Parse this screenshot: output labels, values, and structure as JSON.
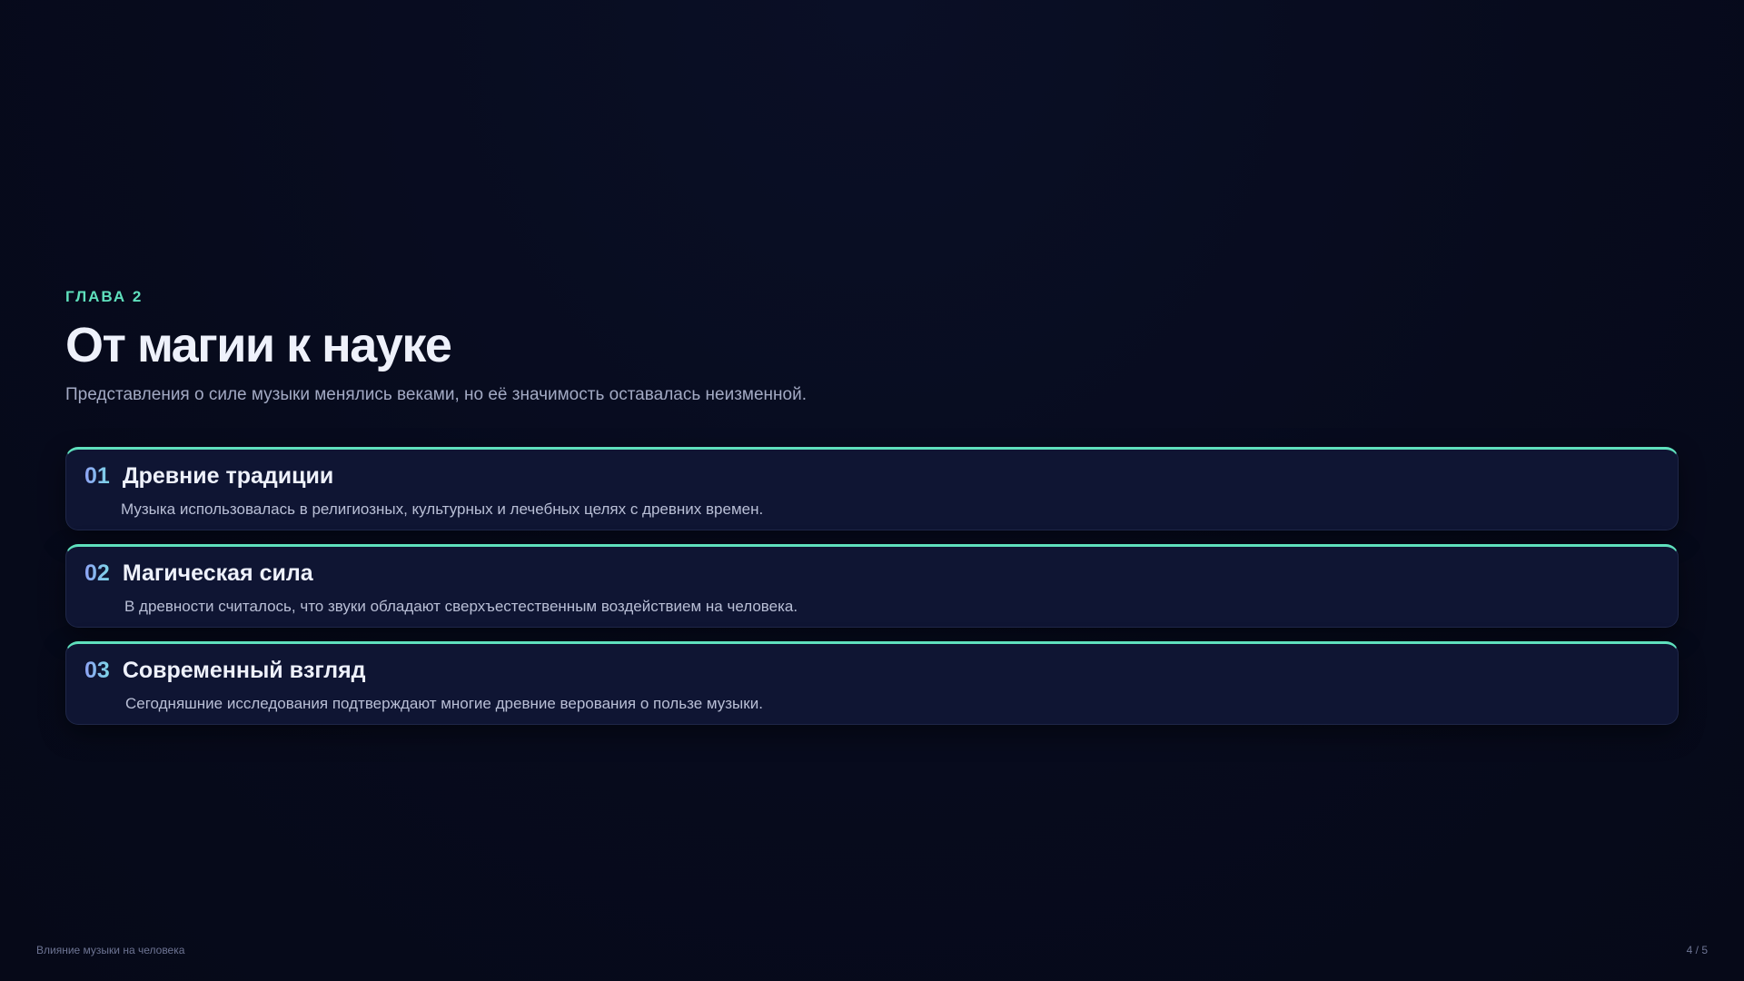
{
  "slide": {
    "eyebrow": "ГЛАВА 2",
    "title": "От магии к науке",
    "subtitle": "Представления о силе музыки менялись веками, но её значимость оставалась неизменной."
  },
  "cards": [
    {
      "number": "01",
      "title": "Древние традиции",
      "description": "Музыка использовалась в религиозных, культурных и лечебных целях с древних времен."
    },
    {
      "number": "02",
      "title": "Магическая сила",
      "description": "В древности считалось, что звуки обладают сверхъестественным воздействием на человека."
    },
    {
      "number": "03",
      "title": "Современный взгляд",
      "description": "Сегодняшние исследования подтверждают многие древние верования о пользе музыки."
    }
  ],
  "footer": {
    "presentation_title": "Влияние музыки на человека",
    "page_indicator": "4 / 5"
  },
  "colors": {
    "background": "#070b1d",
    "accent": "#5fe0bd",
    "number": "#8ea2f5",
    "card": "#0f1533"
  }
}
